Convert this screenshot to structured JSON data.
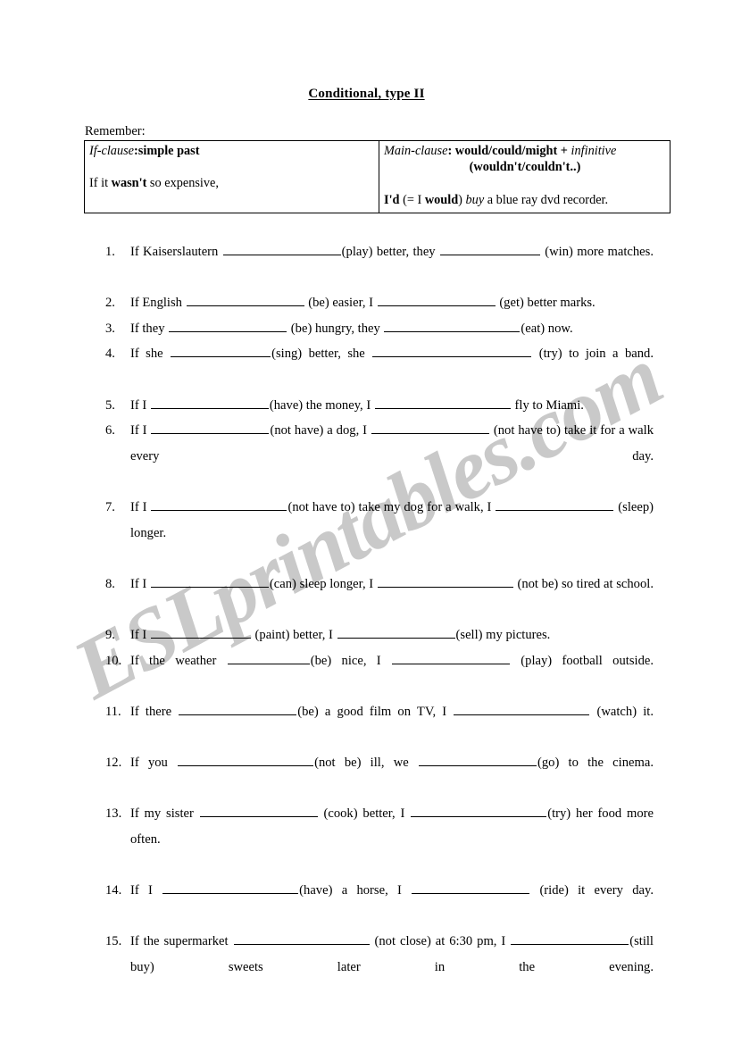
{
  "document": {
    "title": "Conditional, type II",
    "remember_label": "Remember:"
  },
  "grammar_table": {
    "left": {
      "header_italic": "If-clause",
      "header_rest": ":simple past",
      "example_pre": "If it ",
      "example_bold": "wasn't",
      "example_post": " so expensive,"
    },
    "right": {
      "header_italic": "Main-clause",
      "header_bold": ": would/could/might + ",
      "header_italic2": "infinitive",
      "header_sub": "(wouldn't/couldn't..)",
      "example_bold1": "I'd",
      "example_mid": " (= I ",
      "example_bold2": "would",
      "example_close": ") ",
      "example_italic": "buy",
      "example_post": " a blue ray dvd recorder."
    }
  },
  "exercises": [
    {
      "number": "1.",
      "justify": true,
      "parts": [
        {
          "t": "text",
          "v": "If Kaiserslautern "
        },
        {
          "t": "blank",
          "size": "b-lg"
        },
        {
          "t": "text",
          "v": "(play) better, they "
        },
        {
          "t": "blank",
          "size": "b-md"
        },
        {
          "t": "text",
          "v": " (win) more matches."
        }
      ]
    },
    {
      "number": "2.",
      "justify": false,
      "parts": [
        {
          "t": "text",
          "v": "If English "
        },
        {
          "t": "blank",
          "size": "b-lg"
        },
        {
          "t": "text",
          "v": " (be) easier, I "
        },
        {
          "t": "blank",
          "size": "b-lg"
        },
        {
          "t": "text",
          "v": " (get) better marks."
        }
      ]
    },
    {
      "number": "3.",
      "justify": false,
      "parts": [
        {
          "t": "text",
          "v": "If they "
        },
        {
          "t": "blank",
          "size": "b-lg"
        },
        {
          "t": "text",
          "v": " (be) hungry, they "
        },
        {
          "t": "blank",
          "size": "b-xl"
        },
        {
          "t": "text",
          "v": "(eat) now."
        }
      ]
    },
    {
      "number": "4.",
      "justify": true,
      "parts": [
        {
          "t": "text",
          "v": "If she "
        },
        {
          "t": "blank",
          "size": "b-md"
        },
        {
          "t": "text",
          "v": "(sing) better, she "
        },
        {
          "t": "blank",
          "size": "b-xxl"
        },
        {
          "t": "text",
          "v": " (try) to join a band."
        }
      ]
    },
    {
      "number": "5.",
      "justify": false,
      "parts": [
        {
          "t": "text",
          "v": "If I "
        },
        {
          "t": "blank",
          "size": "b-lg"
        },
        {
          "t": "text",
          "v": "(have) the money, I "
        },
        {
          "t": "blank",
          "size": "b-xl"
        },
        {
          "t": "text",
          "v": " fly to Miami."
        }
      ]
    },
    {
      "number": "6.",
      "justify": true,
      "parts": [
        {
          "t": "text",
          "v": "If I "
        },
        {
          "t": "blank",
          "size": "b-lg"
        },
        {
          "t": "text",
          "v": "(not have) a dog, I "
        },
        {
          "t": "blank",
          "size": "b-lg"
        },
        {
          "t": "text",
          "v": " (not have to) take it for a walk every day."
        }
      ]
    },
    {
      "number": "7.",
      "justify": true,
      "parts": [
        {
          "t": "text",
          "v": "If I "
        },
        {
          "t": "blank",
          "size": "b-xl"
        },
        {
          "t": "text",
          "v": "(not have to) take my dog for a walk, I "
        },
        {
          "t": "blank",
          "size": "b-lg"
        },
        {
          "t": "text",
          "v": " (sleep) longer."
        }
      ]
    },
    {
      "number": "8.",
      "justify": true,
      "parts": [
        {
          "t": "text",
          "v": "If I "
        },
        {
          "t": "blank",
          "size": "b-lg"
        },
        {
          "t": "text",
          "v": "(can) sleep longer, I "
        },
        {
          "t": "blank",
          "size": "b-xl"
        },
        {
          "t": "text",
          "v": " (not be) so tired at school."
        }
      ]
    },
    {
      "number": "9.",
      "justify": false,
      "parts": [
        {
          "t": "text",
          "v": "If I "
        },
        {
          "t": "blank",
          "size": "b-md"
        },
        {
          "t": "text",
          "v": " (paint) better, I "
        },
        {
          "t": "blank",
          "size": "b-lg"
        },
        {
          "t": "text",
          "v": "(sell) my pictures."
        }
      ]
    },
    {
      "number": "10.",
      "justify": true,
      "parts": [
        {
          "t": "text",
          "v": "If the weather "
        },
        {
          "t": "blank",
          "size": "b-sm"
        },
        {
          "t": "text",
          "v": "(be) nice, I "
        },
        {
          "t": "blank",
          "size": "b-lg"
        },
        {
          "t": "text",
          "v": " (play) football outside."
        }
      ]
    },
    {
      "number": "11.",
      "justify": true,
      "parts": [
        {
          "t": "text",
          "v": "If there "
        },
        {
          "t": "blank",
          "size": "b-lg"
        },
        {
          "t": "text",
          "v": "(be) a good film on TV, I "
        },
        {
          "t": "blank",
          "size": "b-xl"
        },
        {
          "t": "text",
          "v": " (watch) it."
        }
      ]
    },
    {
      "number": "12.",
      "justify": true,
      "parts": [
        {
          "t": "text",
          "v": "If you "
        },
        {
          "t": "blank",
          "size": "b-xl"
        },
        {
          "t": "text",
          "v": "(not be) ill, we "
        },
        {
          "t": "blank",
          "size": "b-lg"
        },
        {
          "t": "text",
          "v": "(go) to the cinema."
        }
      ]
    },
    {
      "number": "13.",
      "justify": true,
      "parts": [
        {
          "t": "text",
          "v": "If my sister "
        },
        {
          "t": "blank",
          "size": "b-lg"
        },
        {
          "t": "text",
          "v": " (cook) better, I "
        },
        {
          "t": "blank",
          "size": "b-xl"
        },
        {
          "t": "text",
          "v": "(try) her food more often."
        }
      ]
    },
    {
      "number": "14.",
      "justify": true,
      "parts": [
        {
          "t": "text",
          "v": "If I "
        },
        {
          "t": "blank",
          "size": "b-xl"
        },
        {
          "t": "text",
          "v": "(have) a horse, I "
        },
        {
          "t": "blank",
          "size": "b-lg"
        },
        {
          "t": "text",
          "v": " (ride) it every day."
        }
      ]
    },
    {
      "number": "15.",
      "justify": true,
      "parts": [
        {
          "t": "text",
          "v": "If the supermarket "
        },
        {
          "t": "blank",
          "size": "b-xl"
        },
        {
          "t": "text",
          "v": " (not close) at 6:30 pm, I "
        },
        {
          "t": "blank",
          "size": "b-lg"
        },
        {
          "t": "text",
          "v": "(still buy) sweets later in the evening."
        }
      ]
    }
  ],
  "watermark": {
    "text": "ESLprintables.com",
    "color": "#c9c9c9"
  }
}
